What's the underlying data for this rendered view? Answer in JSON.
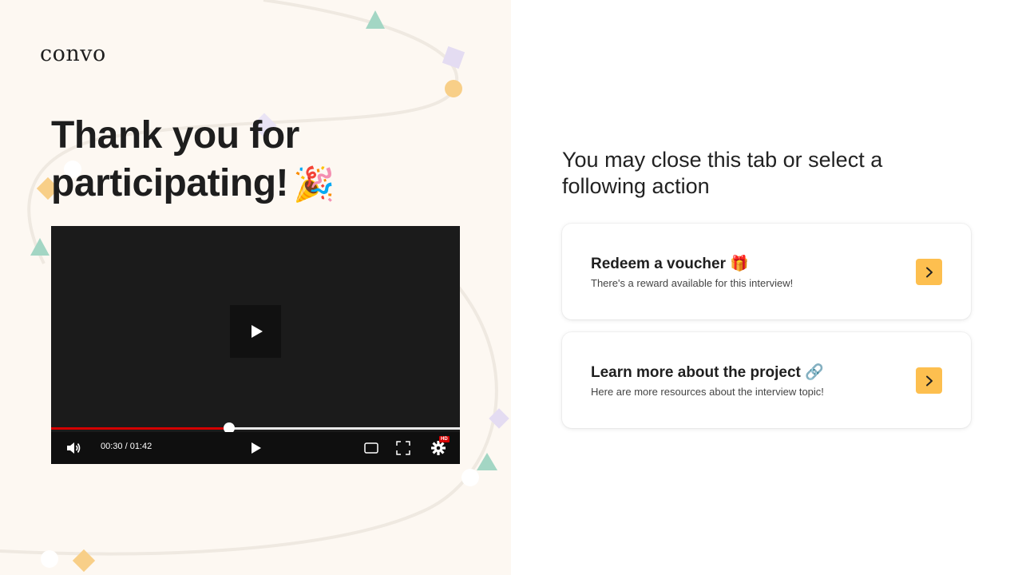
{
  "brand": {
    "logo_text": "convo"
  },
  "headline": {
    "text": "Thank you for participating!",
    "emoji": "🎉"
  },
  "video": {
    "time_display": "00:30 / 01:42",
    "progress": 0.435,
    "hd_badge": "HD",
    "icons": {
      "big_play": "play-icon",
      "volume": "volume-icon",
      "play": "play-icon",
      "theater": "theater-mode-icon",
      "fullscreen": "fullscreen-icon",
      "settings": "gear-icon"
    }
  },
  "actions": {
    "prompt": "You may close this tab or select a following action",
    "cards": [
      {
        "title": "Redeem a voucher",
        "emoji": "🎁",
        "subtitle": "There's a reward available for this interview!",
        "icon": "chevron-right-icon"
      },
      {
        "title": "Learn more about the project",
        "emoji": "🔗",
        "subtitle": "Here are more resources about the interview topic!",
        "icon": "chevron-right-icon"
      }
    ]
  },
  "colors": {
    "left_background": "#fdf8f2",
    "accent_yellow": "#fdbf4f",
    "progress_red": "#d40000",
    "deco_lavender": "#e4dcf2",
    "deco_mint": "#a3d6c4"
  }
}
